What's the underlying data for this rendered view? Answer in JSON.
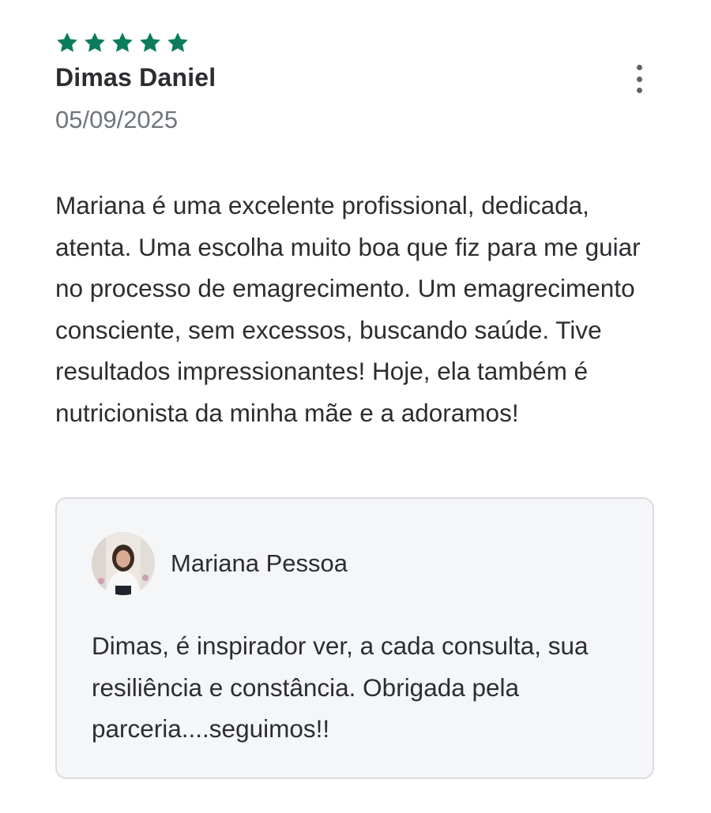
{
  "review": {
    "rating": 5,
    "rating_max": 5,
    "star_color": "#0a7c5c",
    "reviewer_name": "Dimas Daniel",
    "date": "05/09/2025",
    "text": "Mariana é uma excelente profissional, dedicada, atenta. Uma escolha muito boa que fiz para me guiar no processo de emagrecimento. Um emagrecimento consciente, sem excessos, buscando saúde. Tive resultados impressionantes! Hoje, ela também é nutricionista da minha mãe e a adoramos!",
    "more_icon": "more-vert-icon"
  },
  "reply": {
    "author": "Mariana Pessoa",
    "avatar": "avatar-photo",
    "text": "Dimas, é inspirador ver, a cada consulta, sua resiliência e constância. Obrigada pela parceria....seguimos!!"
  }
}
